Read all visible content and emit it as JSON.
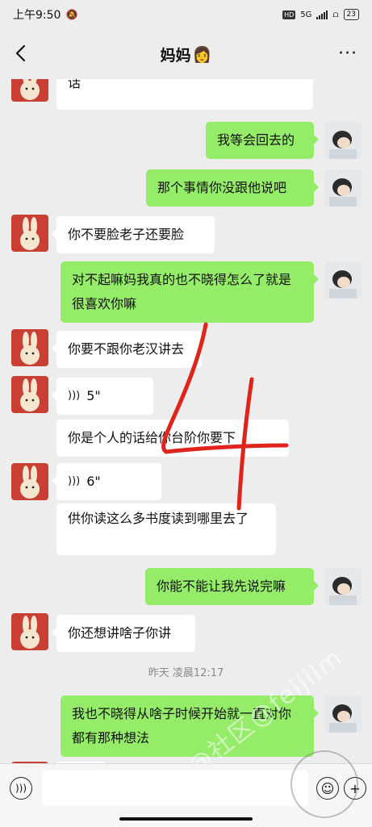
{
  "status_bar": {
    "time": "上午9:50",
    "network": "5G",
    "hd": "HD",
    "battery": "23"
  },
  "header": {
    "title": "妈妈",
    "title_emoji": "👩"
  },
  "icons": {
    "back": "chevron-left-icon",
    "more": "more-dots-icon",
    "voice_input": "voice-input-icon",
    "emoji": "emoji-icon",
    "plus": "plus-icon"
  },
  "colors": {
    "sent_bubble": "#95ec69",
    "received_bubble": "#ffffff",
    "background": "#ededed",
    "scribble": "#e0241b"
  },
  "messages": [
    {
      "side": "left",
      "text": "话",
      "partial_top": "这个是你说的话"
    },
    {
      "side": "right",
      "text": "我等会回去的"
    },
    {
      "side": "right",
      "text": "那个事情你没跟他说吧"
    },
    {
      "side": "left",
      "text": "你不要脸老子还要脸"
    },
    {
      "side": "right",
      "text": "对不起嘛妈我真的也不晓得怎么了就是很喜欢你嘛"
    },
    {
      "side": "left",
      "text": "你要不跟你老汉讲去"
    },
    {
      "side": "left",
      "type": "voice",
      "duration": "5\""
    },
    {
      "side": "left",
      "text": "你是个人的话给你台阶你要下"
    },
    {
      "side": "left",
      "type": "voice",
      "duration": "6\""
    },
    {
      "side": "left",
      "text": "供你读这么多书度读到哪里去了"
    },
    {
      "side": "right",
      "text": "你能不能让我先说完嘛"
    },
    {
      "side": "left",
      "text": "你还想讲啥子你讲"
    },
    {
      "side": "right",
      "text": "我也不晓得从啥子时候开始就一直对你都有那种想法"
    }
  ],
  "timestamp": "昨天 凌晨12:17",
  "watermark": "@社区@feijilm",
  "scribble_text": "4"
}
